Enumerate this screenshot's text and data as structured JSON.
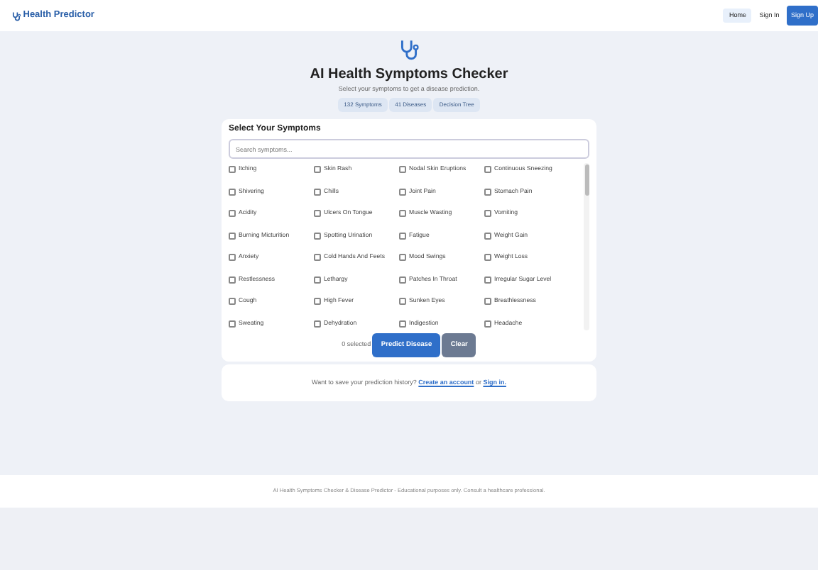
{
  "navbar": {
    "brand": "Health Predictor",
    "links": [
      {
        "label": "Home",
        "selected": true
      },
      {
        "label": "Sign In",
        "selected": false
      }
    ],
    "signup": "Sign Up"
  },
  "hero": {
    "title": "AI Health Symptoms Checker",
    "subtitle": "Select your symptoms to get a disease prediction.",
    "badges": [
      "132 Symptoms",
      "41 Diseases",
      "Decision Tree"
    ]
  },
  "symptoms_card": {
    "title": "Select Your Symptoms",
    "search": {
      "placeholder": "Search symptoms..."
    },
    "symptoms": [
      {
        "label": "Itching",
        "checked": false
      },
      {
        "label": "Skin Rash",
        "checked": false
      },
      {
        "label": "Nodal Skin Eruptions",
        "checked": false
      },
      {
        "label": "Continuous Sneezing",
        "checked": false
      },
      {
        "label": "Shivering",
        "checked": false
      },
      {
        "label": "Chills",
        "checked": false
      },
      {
        "label": "Joint Pain",
        "checked": false
      },
      {
        "label": "Stomach Pain",
        "checked": false
      },
      {
        "label": "Acidity",
        "checked": false
      },
      {
        "label": "Ulcers On Tongue",
        "checked": false
      },
      {
        "label": "Muscle Wasting",
        "checked": false
      },
      {
        "label": "Vomiting",
        "checked": false
      },
      {
        "label": "Burning Micturition",
        "checked": false
      },
      {
        "label": "Spotting Urination",
        "checked": false
      },
      {
        "label": "Fatigue",
        "checked": false
      },
      {
        "label": "Weight Gain",
        "checked": false
      },
      {
        "label": "Anxiety",
        "checked": false
      },
      {
        "label": "Cold Hands And Feets",
        "checked": false
      },
      {
        "label": "Mood Swings",
        "checked": false
      },
      {
        "label": "Weight Loss",
        "checked": false
      },
      {
        "label": "Restlessness",
        "checked": false
      },
      {
        "label": "Lethargy",
        "checked": false
      },
      {
        "label": "Patches In Throat",
        "checked": false
      },
      {
        "label": "Irregular Sugar Level",
        "checked": false
      },
      {
        "label": "Cough",
        "checked": false
      },
      {
        "label": "High Fever",
        "checked": false
      },
      {
        "label": "Sunken Eyes",
        "checked": false
      },
      {
        "label": "Breathlessness",
        "checked": false
      },
      {
        "label": "Sweating",
        "checked": false
      },
      {
        "label": "Dehydration",
        "checked": false
      },
      {
        "label": "Indigestion",
        "checked": false
      },
      {
        "label": "Headache",
        "checked": false
      }
    ],
    "selected_count": "0 selected",
    "predict_button": "Predict Disease",
    "clear_button": "Clear"
  },
  "save_card": {
    "text": "Want to save your prediction history?",
    "link1": "Create an account",
    "middle": "or",
    "link2": "Sign in."
  },
  "footer": "AI Health Symptoms Checker & Disease Predictor - Educational purposes only. Consult a healthcare professional."
}
